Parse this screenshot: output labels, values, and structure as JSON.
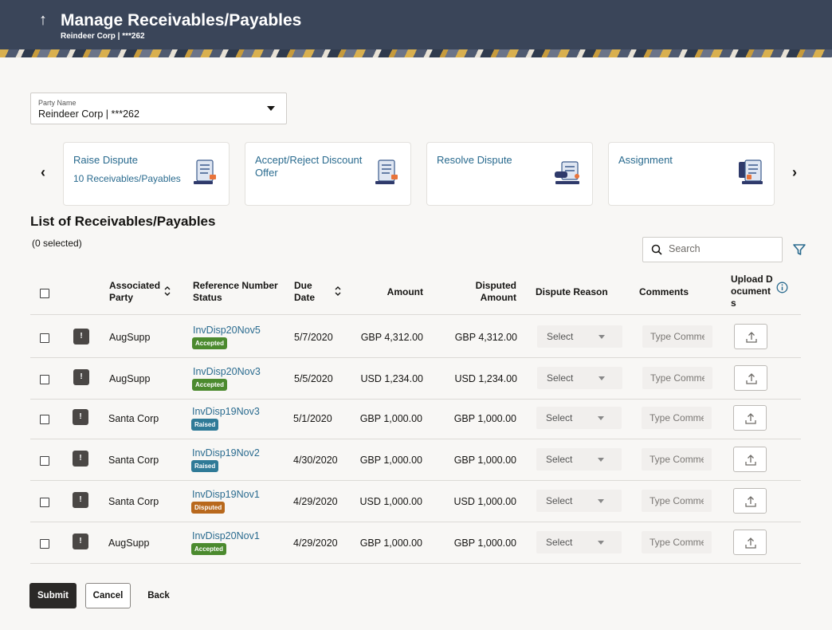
{
  "header": {
    "title": "Manage Receivables/Payables",
    "subtitle": "Reindeer Corp | ***262",
    "back_icon": "up-arrow-icon"
  },
  "colors": {
    "header_bg": "#3a4559",
    "link": "#2a6b8f",
    "accepted": "#4b8a2e",
    "raised": "#2f7a97",
    "disputed": "#b8681c",
    "primary_button": "#2b2927"
  },
  "party": {
    "label": "Party Name",
    "value": "Reindeer Corp | ***262"
  },
  "actions": [
    {
      "title": "Raise Dispute",
      "link": "10 Receivables/Payables",
      "icon": "document-list-icon"
    },
    {
      "title": "Accept/Reject Discount Offer",
      "link": "",
      "icon": "document-list-icon"
    },
    {
      "title": "Resolve Dispute",
      "link": "",
      "icon": "document-hand-icon"
    },
    {
      "title": "Assignment",
      "link": "",
      "icon": "document-stack-icon"
    }
  ],
  "list": {
    "title": "List of Receivables/Payables",
    "selected_text": "(0 selected)",
    "search_placeholder": "Search"
  },
  "columns": {
    "associated_party": "Associated Party",
    "reference": "Reference Number Status",
    "due_date": "Due Date",
    "amount": "Amount",
    "disputed_amount": "Disputed Amount",
    "dispute_reason": "Dispute Reason",
    "comments": "Comments",
    "upload": "Upload Documents"
  },
  "rows": [
    {
      "party": "AugSupp",
      "ref": "InvDisp20Nov5",
      "status": "Accepted",
      "due": "5/7/2020",
      "amount": "GBP 4,312.00",
      "disputed": "GBP 4,312.00",
      "reason": "Select",
      "comment_placeholder": "Type Comme"
    },
    {
      "party": "AugSupp",
      "ref": "InvDisp20Nov3",
      "status": "Accepted",
      "due": "5/5/2020",
      "amount": "USD 1,234.00",
      "disputed": "USD 1,234.00",
      "reason": "Select",
      "comment_placeholder": "Type Comme"
    },
    {
      "party": "Santa Corp",
      "ref": "InvDisp19Nov3",
      "status": "Raised",
      "due": "5/1/2020",
      "amount": "GBP 1,000.00",
      "disputed": "GBP 1,000.00",
      "reason": "Select",
      "comment_placeholder": "Type Comme"
    },
    {
      "party": "Santa Corp",
      "ref": "InvDisp19Nov2",
      "status": "Raised",
      "due": "4/30/2020",
      "amount": "GBP 1,000.00",
      "disputed": "GBP 1,000.00",
      "reason": "Select",
      "comment_placeholder": "Type Comme"
    },
    {
      "party": "Santa Corp",
      "ref": "InvDisp19Nov1",
      "status": "Disputed",
      "due": "4/29/2020",
      "amount": "USD 1,000.00",
      "disputed": "USD 1,000.00",
      "reason": "Select",
      "comment_placeholder": "Type Comme"
    },
    {
      "party": "AugSupp",
      "ref": "InvDisp20Nov1",
      "status": "Accepted",
      "due": "4/29/2020",
      "amount": "GBP 1,000.00",
      "disputed": "GBP 1,000.00",
      "reason": "Select",
      "comment_placeholder": "Type Comme"
    }
  ],
  "buttons": {
    "submit": "Submit",
    "cancel": "Cancel",
    "back": "Back"
  }
}
